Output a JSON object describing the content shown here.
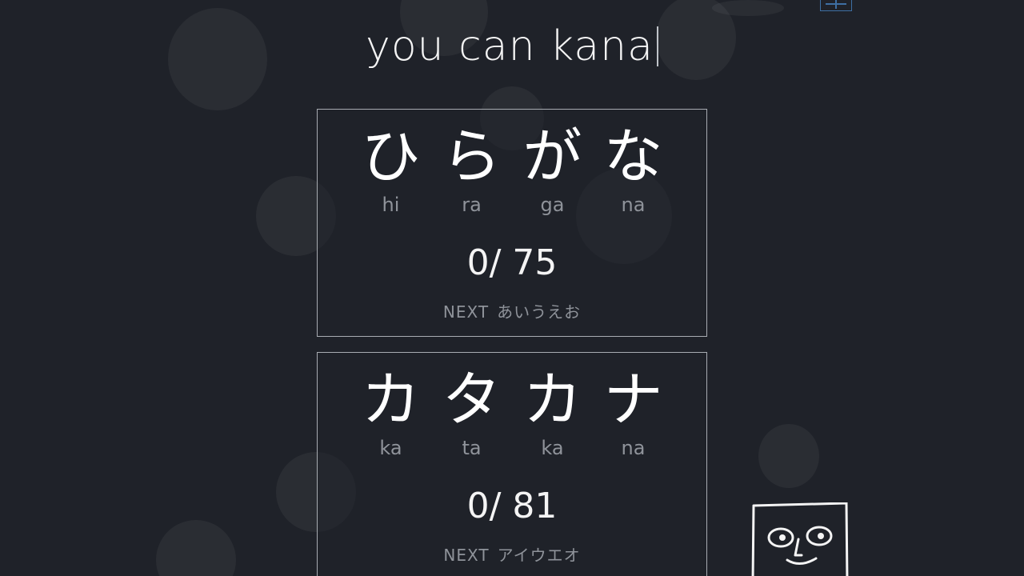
{
  "app": {
    "title": "you can kana"
  },
  "cards": {
    "hiragana": {
      "kana": [
        "ひ",
        "ら",
        "が",
        "な"
      ],
      "romaji": [
        "hi",
        "ra",
        "ga",
        "na"
      ],
      "progress": "0/ 75",
      "next_label": "NEXT",
      "next_set": "あいうえお"
    },
    "katakana": {
      "kana": [
        "カ",
        "タ",
        "カ",
        "ナ"
      ],
      "romaji": [
        "ka",
        "ta",
        "ka",
        "na"
      ],
      "progress": "0/ 81",
      "next_label": "NEXT",
      "next_set": "アイウエオ"
    }
  },
  "icons": {
    "settings": "sliders-icon",
    "mascot": "box-face-mascot"
  },
  "colors": {
    "background": "#1f2229",
    "card_border": "#a8acb2",
    "muted_text": "#8f939a",
    "settings_border": "#3e6fa3"
  }
}
